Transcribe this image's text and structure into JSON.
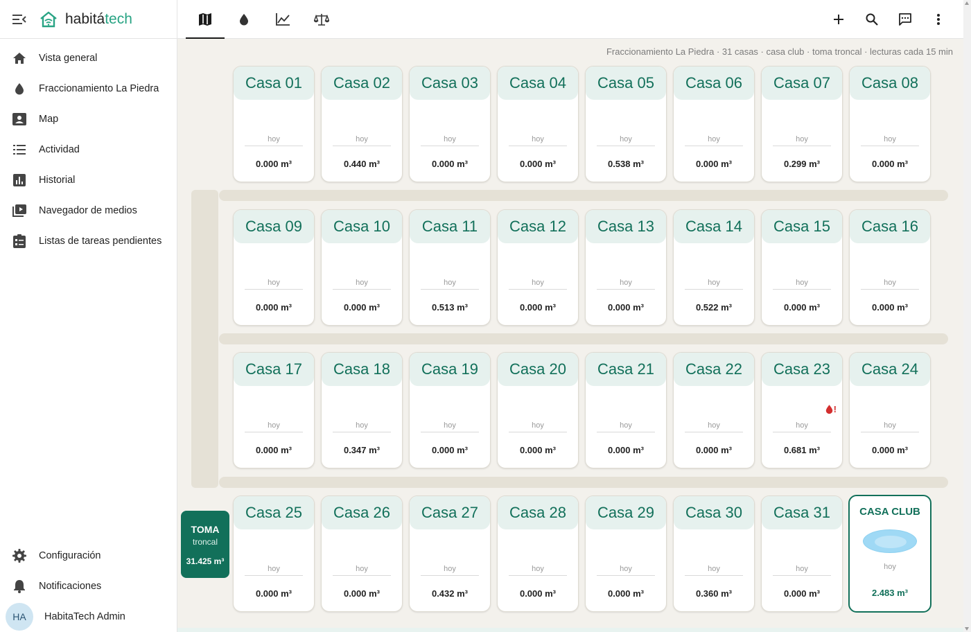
{
  "brand": {
    "part1": "habitá",
    "part2": "tech",
    "accent": "#27a383"
  },
  "sidebar": {
    "items": [
      {
        "label": "Vista general",
        "icon": "home-icon"
      },
      {
        "label": "Fraccionamiento La Piedra",
        "icon": "water-drop-icon"
      },
      {
        "label": "Map",
        "icon": "map-icon"
      },
      {
        "label": "Actividad",
        "icon": "list-icon"
      },
      {
        "label": "Historial",
        "icon": "chart-icon"
      },
      {
        "label": "Navegador de medios",
        "icon": "media-icon"
      },
      {
        "label": "Listas de tareas pendientes",
        "icon": "todo-icon"
      }
    ],
    "bottom": [
      {
        "label": "Configuración",
        "icon": "gear-icon"
      },
      {
        "label": "Notificaciones",
        "icon": "bell-icon"
      }
    ],
    "user": {
      "initials": "HA",
      "name": "HabitaTech Admin"
    }
  },
  "topbar": {
    "tabs": [
      "map-icon",
      "water-drop-icon",
      "line-chart-icon",
      "scale-icon"
    ],
    "active_tab": 0,
    "actions": [
      "plus-icon",
      "search-icon",
      "chat-icon",
      "more-vert-icon"
    ]
  },
  "main": {
    "info": "Fraccionamiento La Piedra · 31 casas · casa club · toma troncal · lecturas cada 15 min",
    "houses": [
      {
        "name": "Casa 01",
        "period": "hoy",
        "value": "0.000 m³"
      },
      {
        "name": "Casa 02",
        "period": "hoy",
        "value": "0.440 m³"
      },
      {
        "name": "Casa 03",
        "period": "hoy",
        "value": "0.000 m³"
      },
      {
        "name": "Casa 04",
        "period": "hoy",
        "value": "0.000 m³"
      },
      {
        "name": "Casa 05",
        "period": "hoy",
        "value": "0.538 m³"
      },
      {
        "name": "Casa 06",
        "period": "hoy",
        "value": "0.000 m³"
      },
      {
        "name": "Casa 07",
        "period": "hoy",
        "value": "0.299 m³"
      },
      {
        "name": "Casa 08",
        "period": "hoy",
        "value": "0.000 m³"
      },
      {
        "name": "Casa 09",
        "period": "hoy",
        "value": "0.000 m³"
      },
      {
        "name": "Casa 10",
        "period": "hoy",
        "value": "0.000 m³"
      },
      {
        "name": "Casa 11",
        "period": "hoy",
        "value": "0.513 m³"
      },
      {
        "name": "Casa 12",
        "period": "hoy",
        "value": "0.000 m³"
      },
      {
        "name": "Casa 13",
        "period": "hoy",
        "value": "0.000 m³"
      },
      {
        "name": "Casa 14",
        "period": "hoy",
        "value": "0.522 m³"
      },
      {
        "name": "Casa 15",
        "period": "hoy",
        "value": "0.000 m³"
      },
      {
        "name": "Casa 16",
        "period": "hoy",
        "value": "0.000 m³"
      },
      {
        "name": "Casa 17",
        "period": "hoy",
        "value": "0.000 m³"
      },
      {
        "name": "Casa 18",
        "period": "hoy",
        "value": "0.347 m³"
      },
      {
        "name": "Casa 19",
        "period": "hoy",
        "value": "0.000 m³"
      },
      {
        "name": "Casa 20",
        "period": "hoy",
        "value": "0.000 m³"
      },
      {
        "name": "Casa 21",
        "period": "hoy",
        "value": "0.000 m³"
      },
      {
        "name": "Casa 22",
        "period": "hoy",
        "value": "0.000 m³"
      },
      {
        "name": "Casa 23",
        "period": "hoy",
        "value": "0.681 m³",
        "alert": "!"
      },
      {
        "name": "Casa 24",
        "period": "hoy",
        "value": "0.000 m³"
      },
      {
        "name": "Casa 25",
        "period": "hoy",
        "value": "0.000 m³"
      },
      {
        "name": "Casa 26",
        "period": "hoy",
        "value": "0.000 m³"
      },
      {
        "name": "Casa 27",
        "period": "hoy",
        "value": "0.432 m³"
      },
      {
        "name": "Casa 28",
        "period": "hoy",
        "value": "0.000 m³"
      },
      {
        "name": "Casa 29",
        "period": "hoy",
        "value": "0.000 m³"
      },
      {
        "name": "Casa 30",
        "period": "hoy",
        "value": "0.360 m³"
      },
      {
        "name": "Casa 31",
        "period": "hoy",
        "value": "0.000 m³"
      }
    ],
    "club": {
      "name": "CASA CLUB",
      "period": "hoy",
      "value": "2.483 m³"
    },
    "toma": {
      "title": "TOMA",
      "subtitle": "troncal",
      "value": "31.425 m³"
    },
    "colors": {
      "primary": "#12705a",
      "alert": "#d32f2f",
      "road": "#e5e1d6",
      "background": "#f3f1ec"
    }
  }
}
